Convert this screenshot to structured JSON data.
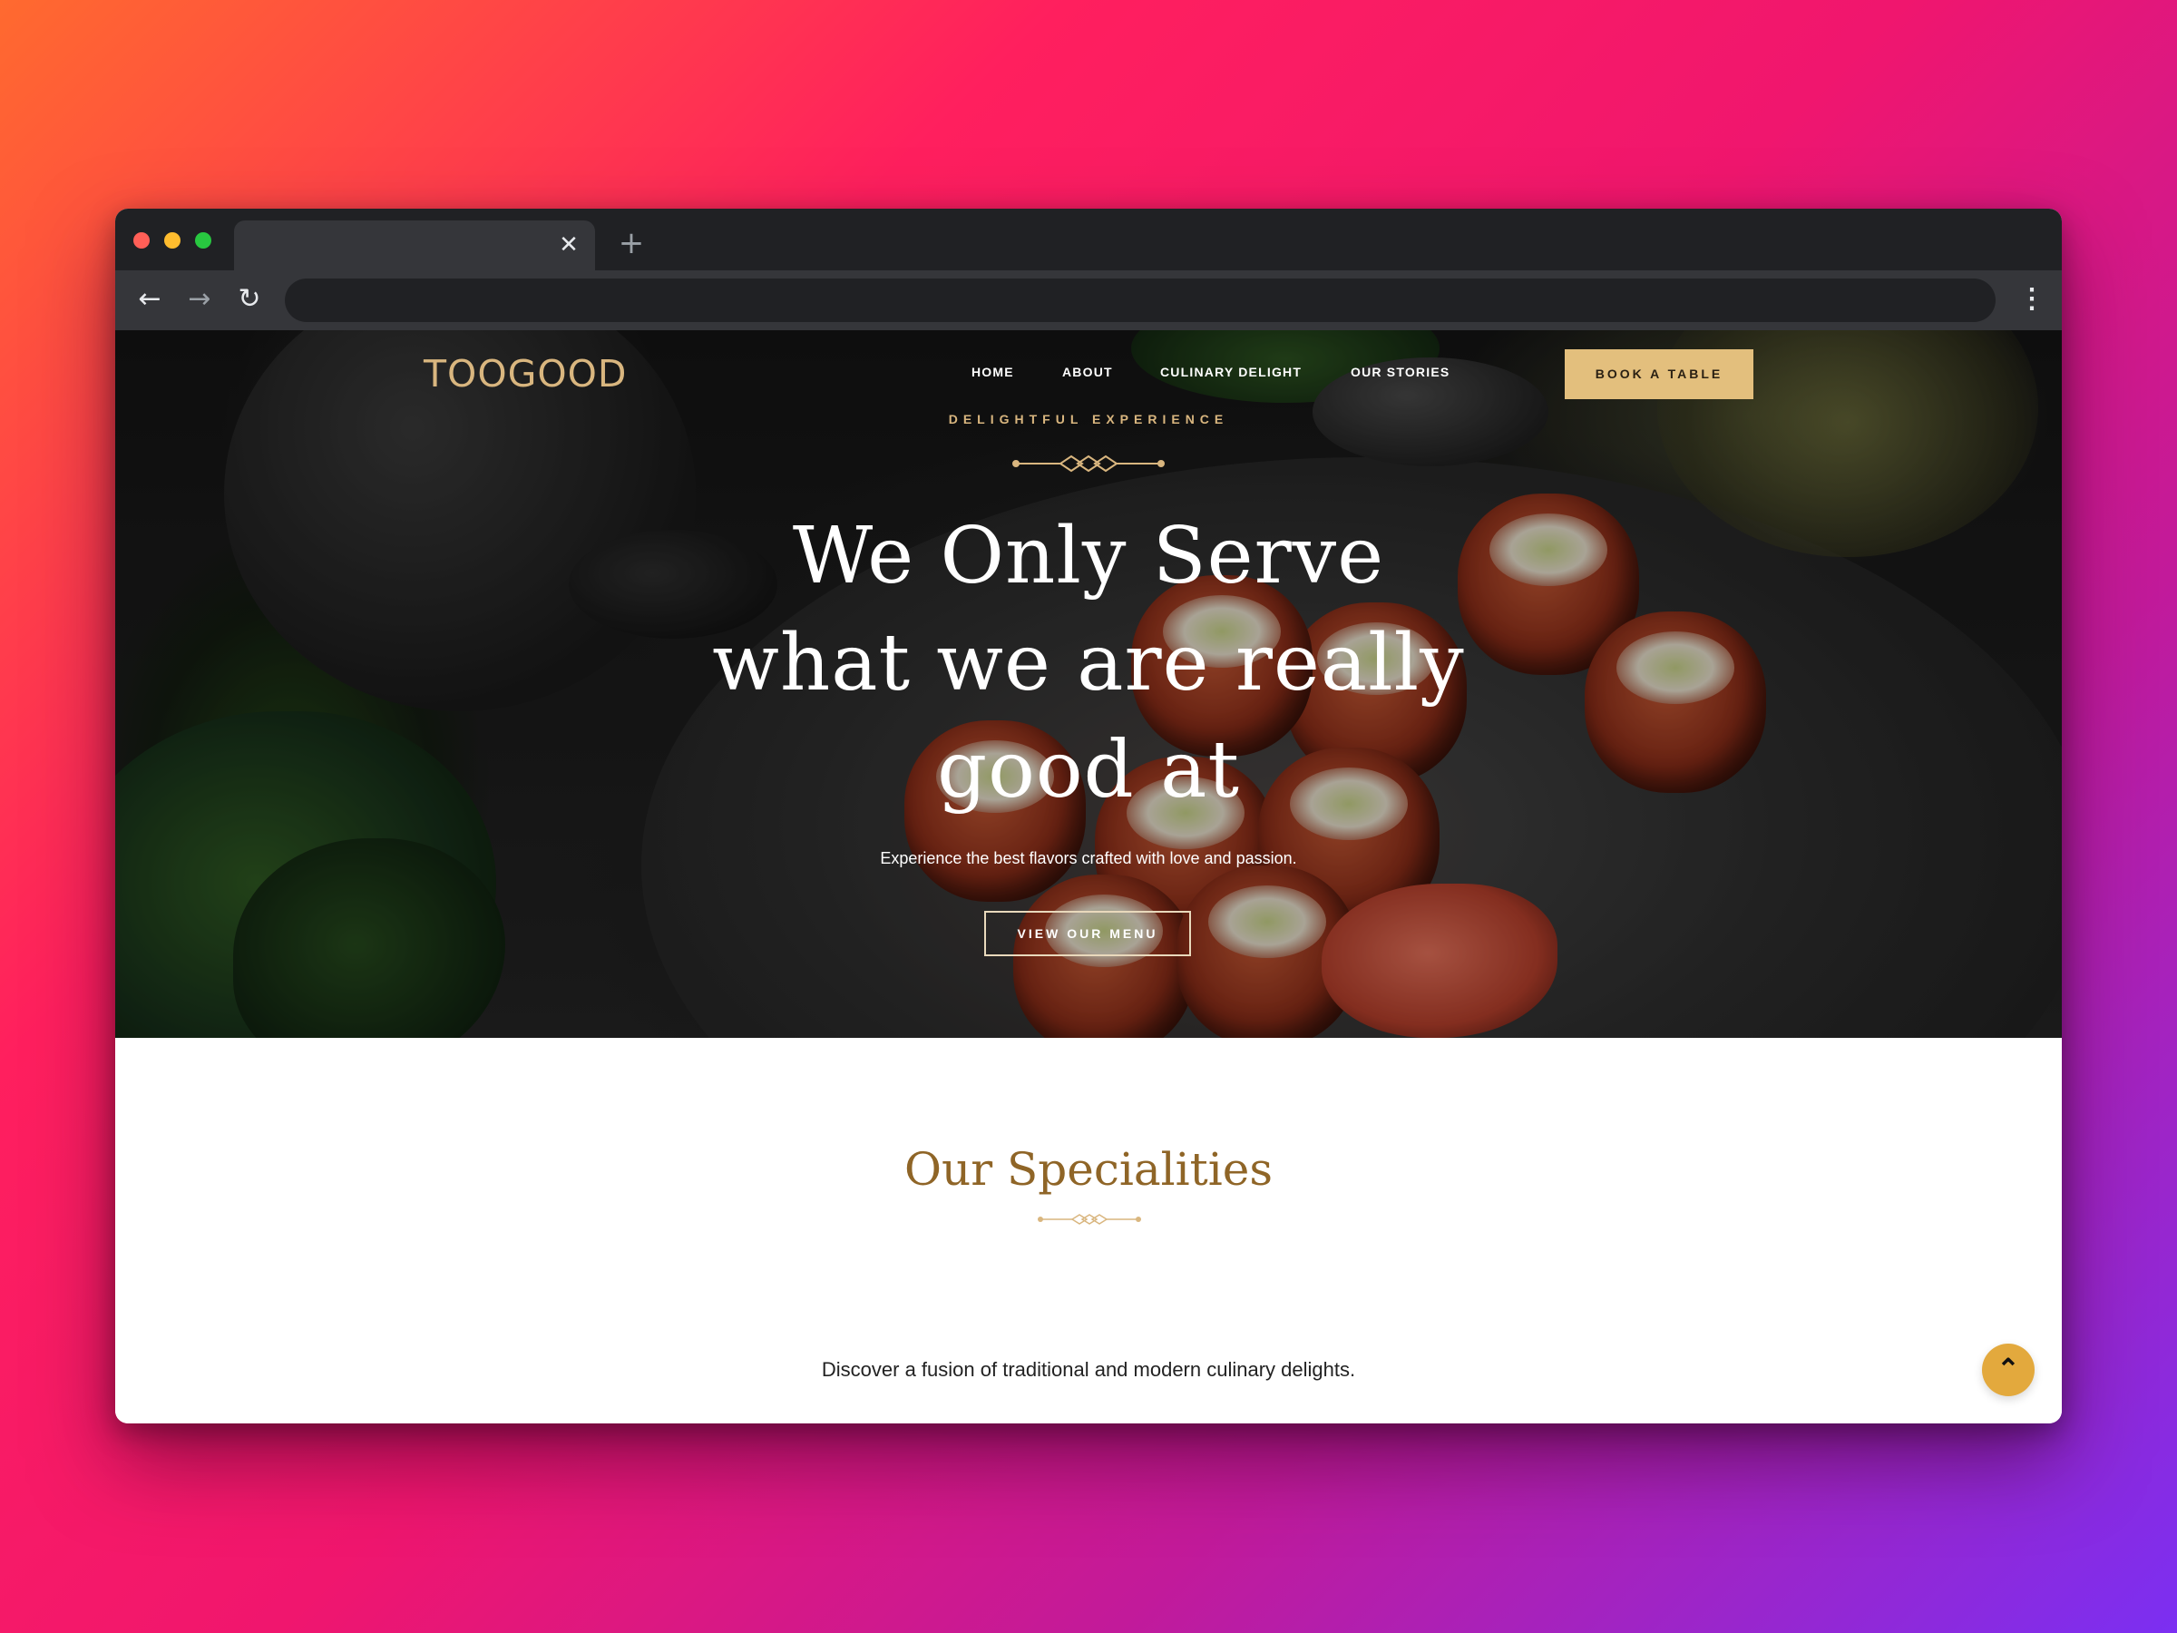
{
  "browser": {
    "tab_title": "",
    "tab_close_icon": "close-icon",
    "new_tab_icon": "plus-icon",
    "address": "",
    "back_icon": "arrow-left-icon",
    "forward_icon": "arrow-right-icon",
    "reload_icon": "reload-icon",
    "menu_icon": "vertical-dots-icon"
  },
  "site": {
    "logo": "TOOGOOD",
    "nav": {
      "home": "HOME",
      "about": "ABOUT",
      "culinary": "CULINARY DELIGHT",
      "stories": "OUR STORIES"
    },
    "book_button": "BOOK A TABLE",
    "accent_color": "#e3bf7d"
  },
  "hero": {
    "eyebrow": "DELIGHTFUL EXPERIENCE",
    "headline_line1": "We Only Serve",
    "headline_line2": "what we are really",
    "headline_line3": "good at",
    "subtext": "Experience the best flavors crafted with love and passion.",
    "cta": "VIEW OUR MENU"
  },
  "specialities": {
    "title": "Our Specialities",
    "subtitle": "Discover a fusion of traditional and modern culinary delights."
  },
  "scroll_top_icon": "chevron-up-icon"
}
